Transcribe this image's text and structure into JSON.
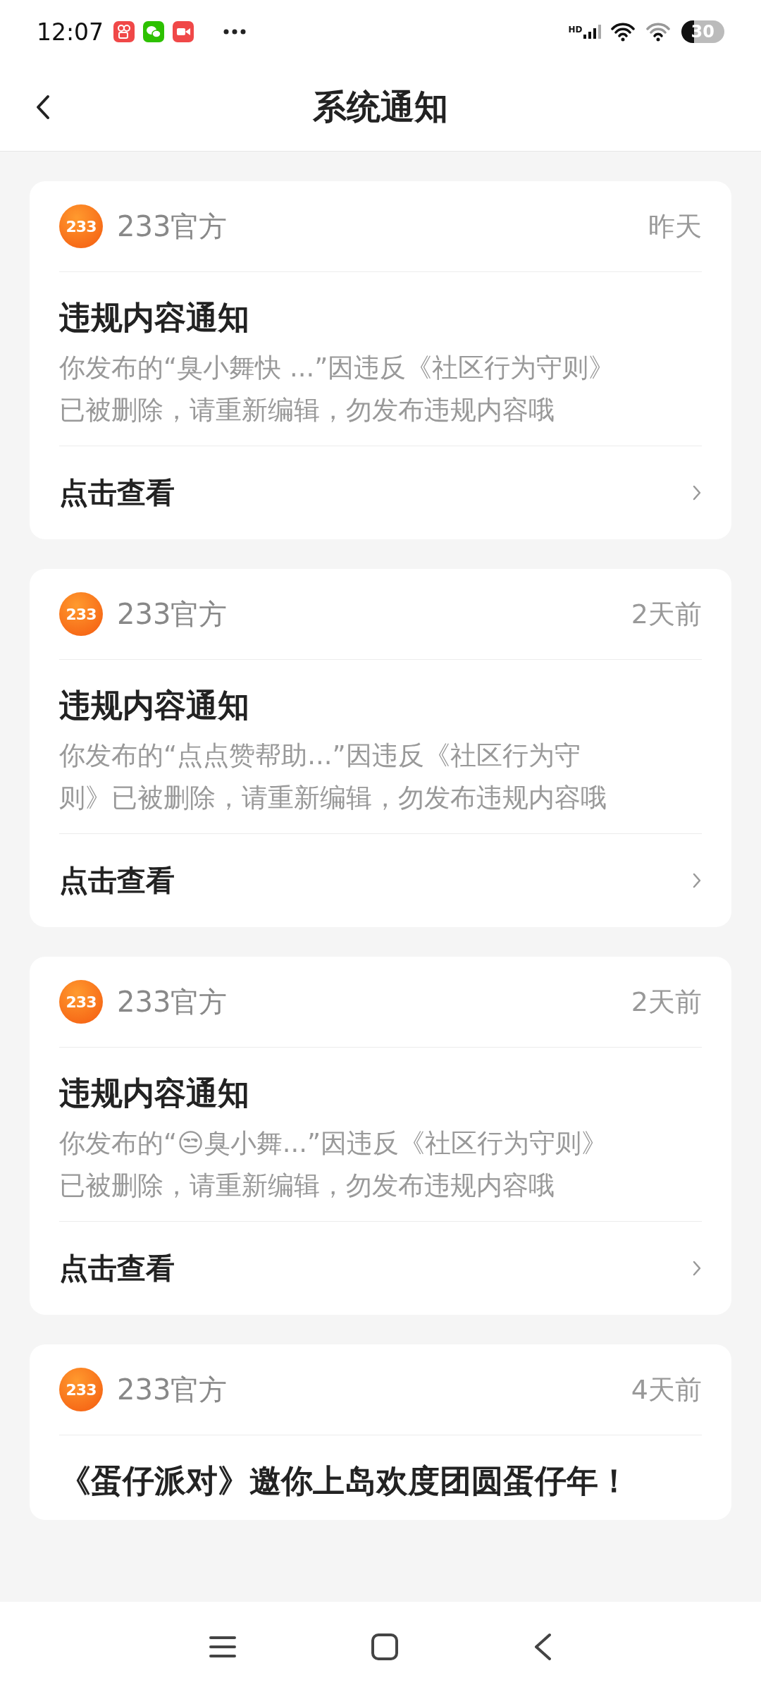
{
  "status_bar": {
    "time": "12:07",
    "network": "HD",
    "battery": "30"
  },
  "header": {
    "title": "系统通知"
  },
  "notifications": [
    {
      "logo_text": "233",
      "sender": "233官方",
      "time": "昨天",
      "title": "违规内容通知",
      "body_lines": [
        "你发布的“臭小舞快 ...”因违反《社区行为守则》",
        "已被删除，请重新编辑，勿发布违规内容哦"
      ],
      "action": "点击查看"
    },
    {
      "logo_text": "233",
      "sender": "233官方",
      "time": "2天前",
      "title": "违规内容通知",
      "body_lines": [
        "你发布的“点点赞帮助...”因违反《社区行为守",
        "则》已被删除，请重新编辑，勿发布违规内容哦"
      ],
      "action": "点击查看"
    },
    {
      "logo_text": "233",
      "sender": "233官方",
      "time": "2天前",
      "title": "违规内容通知",
      "body_lines": [
        "你发布的“😒臭小舞...”因违反《社区行为守则》",
        "已被删除，请重新编辑，勿发布违规内容哦"
      ],
      "action": "点击查看"
    },
    {
      "logo_text": "233",
      "sender": "233官方",
      "time": "4天前",
      "title": "《蛋仔派对》邀你上岛欢度团圆蛋仔年！"
    }
  ]
}
